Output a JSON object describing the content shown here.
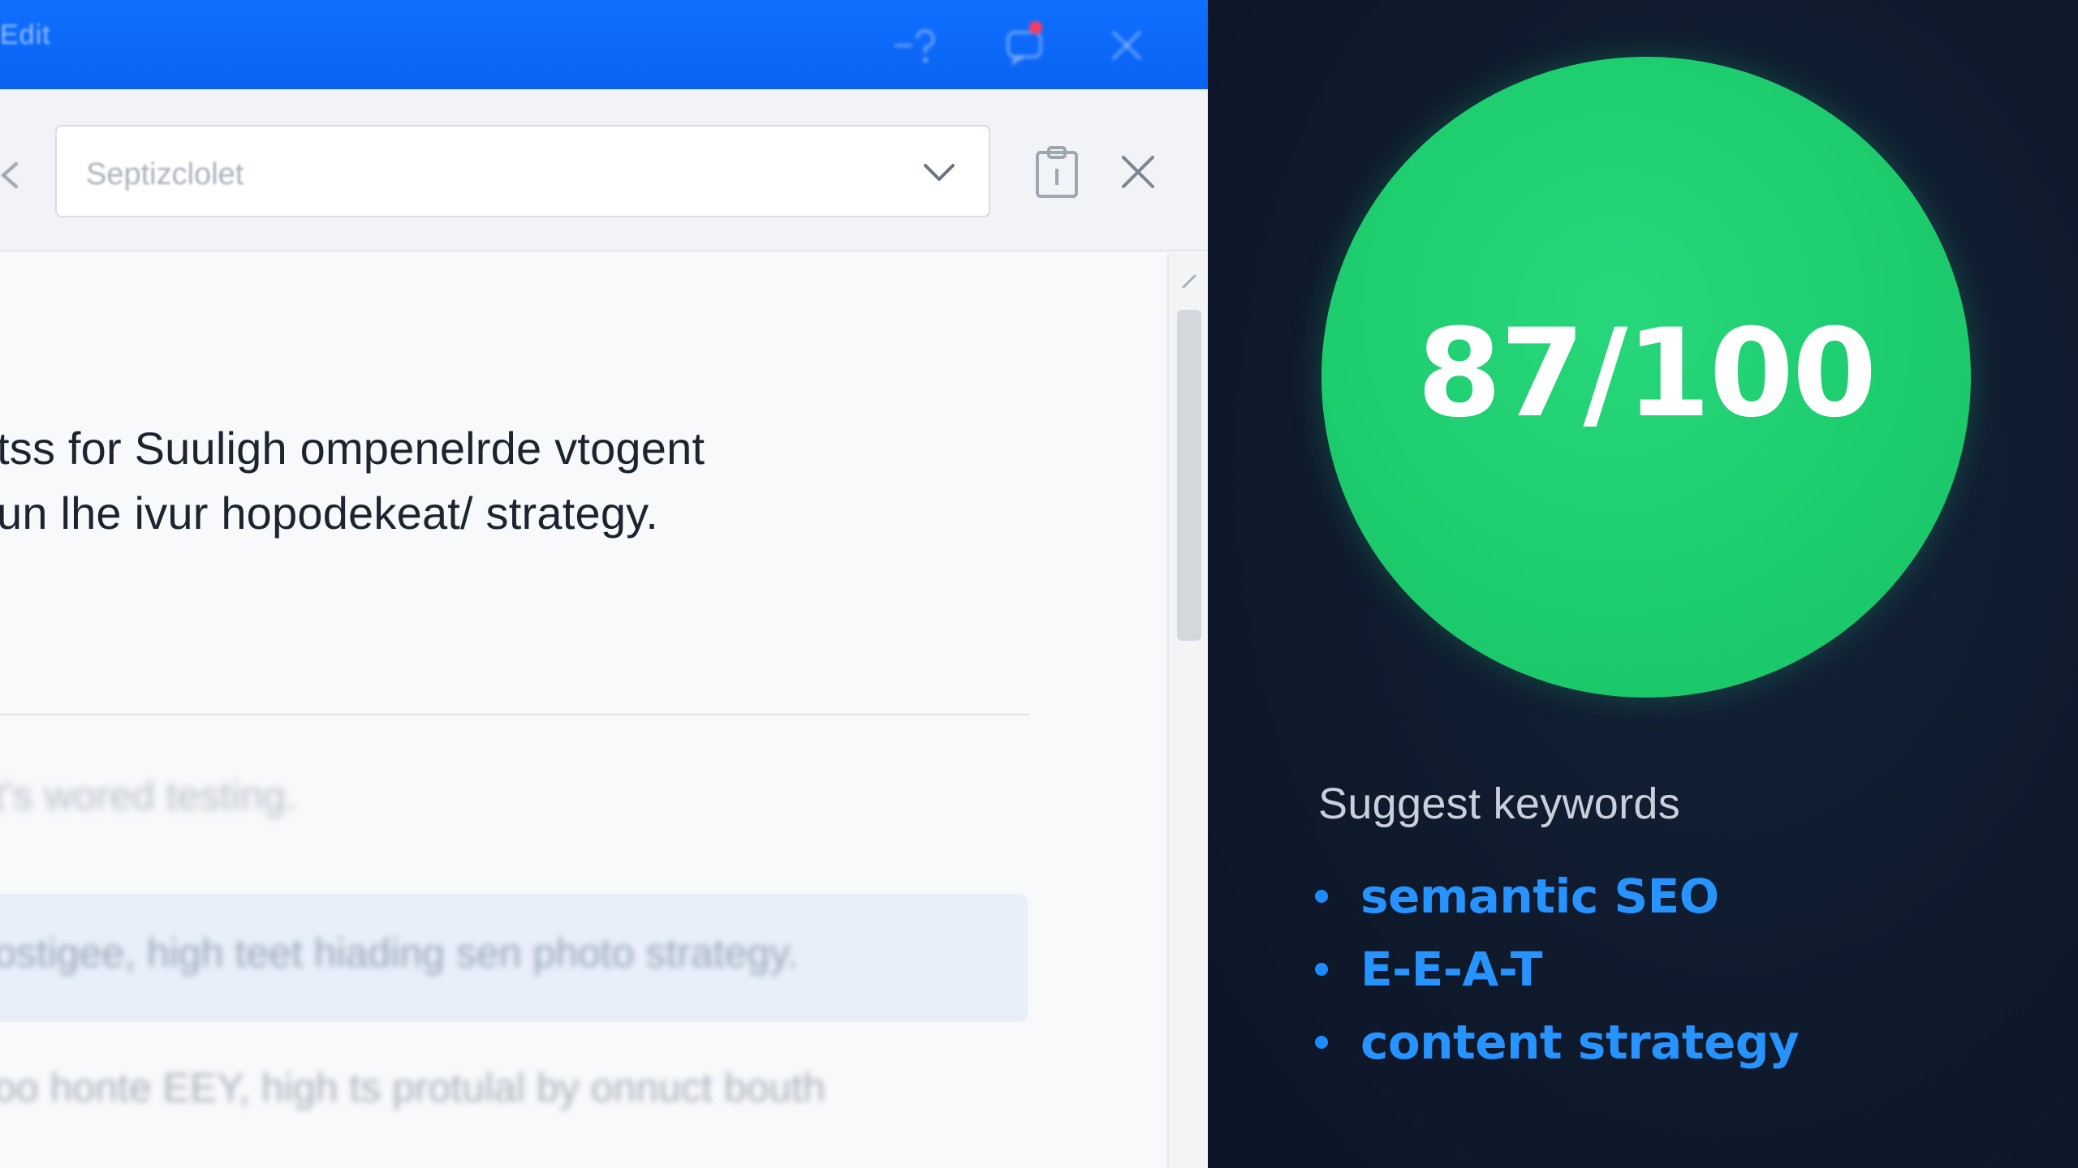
{
  "window": {
    "title": "Edit"
  },
  "toolbar": {
    "select_value": "Septizclolet"
  },
  "content": {
    "line1": "tss for Suuligh ompenelrde vtogent",
    "line2": "un lhe ivur hopodekeat/ strategy.",
    "faded1": "t's wored testing.",
    "faded2": "ostigee, high teet hiading sen photo strategy.",
    "faded3": "oo honte  EEY, high ts protulal by onnuct bouth"
  },
  "score_panel": {
    "score": "87/100",
    "suggest_title": "Suggest keywords",
    "keywords": [
      "semantic SEO",
      "E-E-A-T",
      "content strategy"
    ]
  },
  "colors": {
    "titlebar": "#0a63f2",
    "score_green": "#1ccb6c",
    "keyword_blue": "#2693ff",
    "panel_bg": "#0f1a2d"
  }
}
